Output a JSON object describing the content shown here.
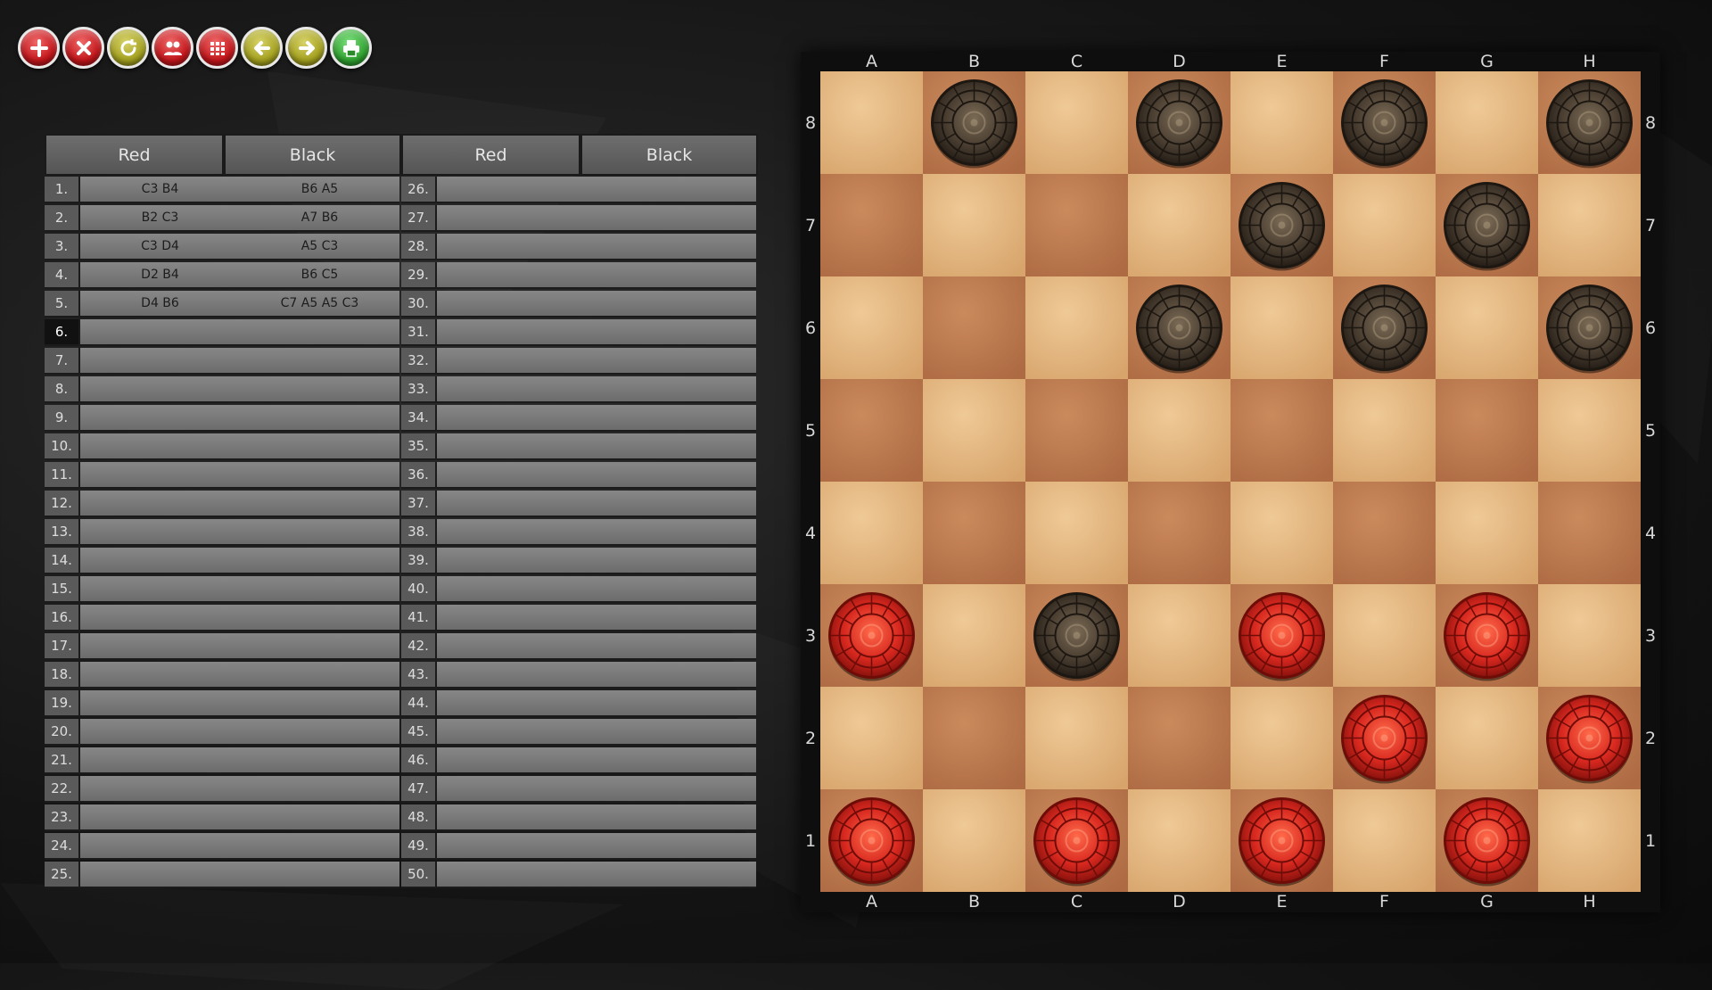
{
  "toolbar": {
    "buttons": [
      {
        "name": "new-game-button",
        "icon": "plus-icon",
        "color": "red"
      },
      {
        "name": "close-button",
        "icon": "x-icon",
        "color": "red"
      },
      {
        "name": "restart-button",
        "icon": "refresh-icon",
        "color": "olive"
      },
      {
        "name": "players-button",
        "icon": "users-icon",
        "color": "red"
      },
      {
        "name": "menu-button",
        "icon": "grid-icon",
        "color": "red"
      },
      {
        "name": "undo-button",
        "icon": "arrow-left-icon",
        "color": "olive"
      },
      {
        "name": "redo-button",
        "icon": "arrow-right-icon",
        "color": "olive"
      },
      {
        "name": "print-button",
        "icon": "printer-icon",
        "color": "green"
      }
    ]
  },
  "move_table": {
    "headers": [
      "Red",
      "Black",
      "Red",
      "Black"
    ],
    "active_move": 6,
    "moves": [
      {
        "n": "1.",
        "red": "C3 B4",
        "black": "B6 A5"
      },
      {
        "n": "2.",
        "red": "B2 C3",
        "black": "A7 B6"
      },
      {
        "n": "3.",
        "red": "C3 D4",
        "black": "A5 C3"
      },
      {
        "n": "4.",
        "red": "D2 B4",
        "black": "B6 C5"
      },
      {
        "n": "5.",
        "red": "D4 B6",
        "black": "C7 A5 A5 C3"
      },
      {
        "n": "6.",
        "red": "",
        "black": ""
      },
      {
        "n": "7.",
        "red": "",
        "black": ""
      },
      {
        "n": "8.",
        "red": "",
        "black": ""
      },
      {
        "n": "9.",
        "red": "",
        "black": ""
      },
      {
        "n": "10.",
        "red": "",
        "black": ""
      },
      {
        "n": "11.",
        "red": "",
        "black": ""
      },
      {
        "n": "12.",
        "red": "",
        "black": ""
      },
      {
        "n": "13.",
        "red": "",
        "black": ""
      },
      {
        "n": "14.",
        "red": "",
        "black": ""
      },
      {
        "n": "15.",
        "red": "",
        "black": ""
      },
      {
        "n": "16.",
        "red": "",
        "black": ""
      },
      {
        "n": "17.",
        "red": "",
        "black": ""
      },
      {
        "n": "18.",
        "red": "",
        "black": ""
      },
      {
        "n": "19.",
        "red": "",
        "black": ""
      },
      {
        "n": "20.",
        "red": "",
        "black": ""
      },
      {
        "n": "21.",
        "red": "",
        "black": ""
      },
      {
        "n": "22.",
        "red": "",
        "black": ""
      },
      {
        "n": "23.",
        "red": "",
        "black": ""
      },
      {
        "n": "24.",
        "red": "",
        "black": ""
      },
      {
        "n": "25.",
        "red": "",
        "black": ""
      },
      {
        "n": "26.",
        "red": "",
        "black": ""
      },
      {
        "n": "27.",
        "red": "",
        "black": ""
      },
      {
        "n": "28.",
        "red": "",
        "black": ""
      },
      {
        "n": "29.",
        "red": "",
        "black": ""
      },
      {
        "n": "30.",
        "red": "",
        "black": ""
      },
      {
        "n": "31.",
        "red": "",
        "black": ""
      },
      {
        "n": "32.",
        "red": "",
        "black": ""
      },
      {
        "n": "33.",
        "red": "",
        "black": ""
      },
      {
        "n": "34.",
        "red": "",
        "black": ""
      },
      {
        "n": "35.",
        "red": "",
        "black": ""
      },
      {
        "n": "36.",
        "red": "",
        "black": ""
      },
      {
        "n": "37.",
        "red": "",
        "black": ""
      },
      {
        "n": "38.",
        "red": "",
        "black": ""
      },
      {
        "n": "39.",
        "red": "",
        "black": ""
      },
      {
        "n": "40.",
        "red": "",
        "black": ""
      },
      {
        "n": "41.",
        "red": "",
        "black": ""
      },
      {
        "n": "42.",
        "red": "",
        "black": ""
      },
      {
        "n": "43.",
        "red": "",
        "black": ""
      },
      {
        "n": "44.",
        "red": "",
        "black": ""
      },
      {
        "n": "45.",
        "red": "",
        "black": ""
      },
      {
        "n": "46.",
        "red": "",
        "black": ""
      },
      {
        "n": "47.",
        "red": "",
        "black": ""
      },
      {
        "n": "48.",
        "red": "",
        "black": ""
      },
      {
        "n": "49.",
        "red": "",
        "black": ""
      },
      {
        "n": "50.",
        "red": "",
        "black": ""
      }
    ]
  },
  "board": {
    "files": [
      "A",
      "B",
      "C",
      "D",
      "E",
      "F",
      "G",
      "H"
    ],
    "ranks": [
      "8",
      "7",
      "6",
      "5",
      "4",
      "3",
      "2",
      "1"
    ],
    "colors": {
      "light": "#e2b27a",
      "dark": "#c07c4f",
      "red_piece": "#d8281f",
      "black_piece": "#4a3e31"
    },
    "pieces": [
      {
        "square": "B8",
        "color": "black"
      },
      {
        "square": "D8",
        "color": "black"
      },
      {
        "square": "F8",
        "color": "black"
      },
      {
        "square": "H8",
        "color": "black"
      },
      {
        "square": "E7",
        "color": "black"
      },
      {
        "square": "G7",
        "color": "black"
      },
      {
        "square": "D6",
        "color": "black"
      },
      {
        "square": "F6",
        "color": "black"
      },
      {
        "square": "H6",
        "color": "black"
      },
      {
        "square": "A3",
        "color": "red"
      },
      {
        "square": "C3",
        "color": "black"
      },
      {
        "square": "E3",
        "color": "red"
      },
      {
        "square": "G3",
        "color": "red"
      },
      {
        "square": "F2",
        "color": "red"
      },
      {
        "square": "H2",
        "color": "red"
      },
      {
        "square": "A1",
        "color": "red"
      },
      {
        "square": "C1",
        "color": "red"
      },
      {
        "square": "E1",
        "color": "red"
      },
      {
        "square": "G1",
        "color": "red"
      }
    ]
  }
}
